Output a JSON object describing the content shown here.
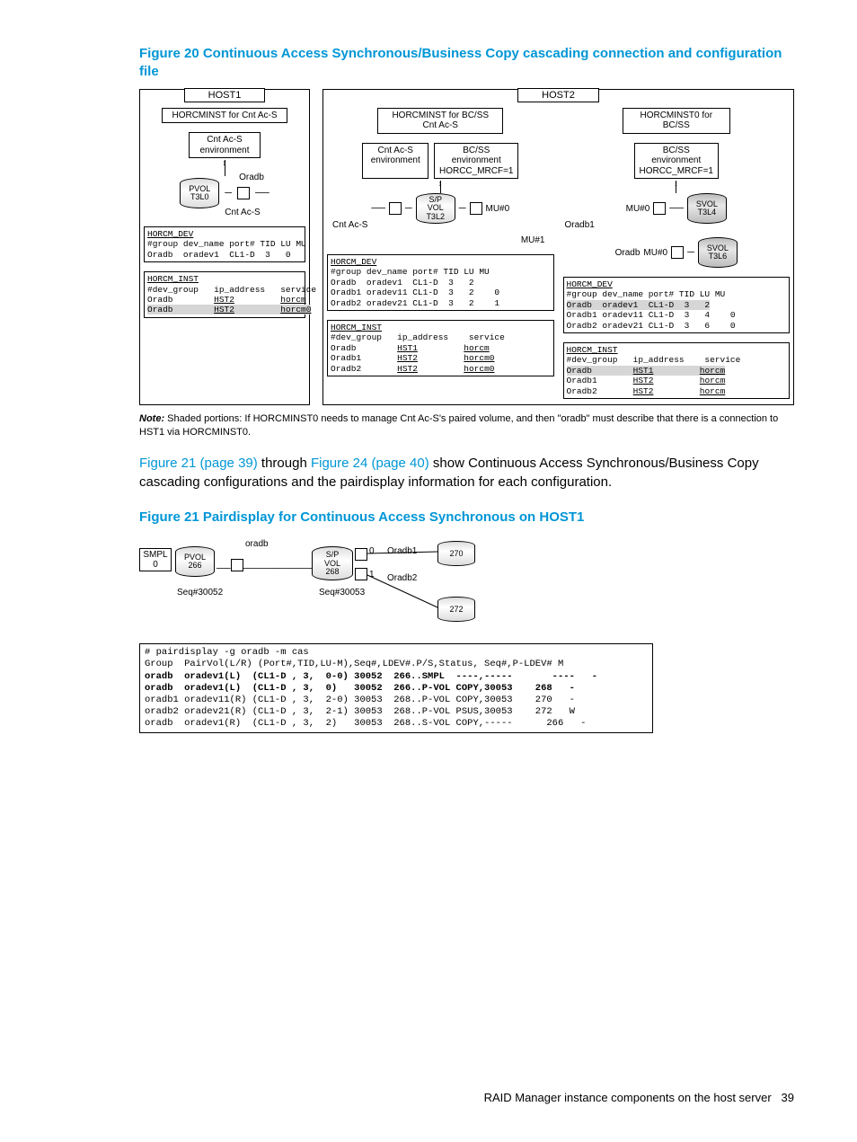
{
  "figure20": {
    "title": "Figure 20  Continuous Access Synchronous/Business Copy cascading connection and configuration file",
    "host1": {
      "label": "HOST1",
      "horcm": "HORCMINST for Cnt Ac-S",
      "env": "Cnt Ac-S\nenvironment",
      "vol": {
        "t1": "PVOL",
        "t2": "T3L0"
      },
      "oradb": "Oradb",
      "link_lbl": "Cnt Ac-S",
      "dev": {
        "head": "HORCM_DEV",
        "hdr": "#group dev_name port# TID LU MU",
        "rows": [
          "Oradb  oradev1  CL1-D  3   0"
        ]
      },
      "inst": {
        "head": "HORCM_INST",
        "hdr": "#dev_group   ip_address   service",
        "rows": [
          [
            "Oradb",
            "HST2",
            "horcm"
          ],
          [
            "Oradb",
            "HST2",
            "horcm0"
          ]
        ]
      }
    },
    "host2": {
      "label": "HOST2",
      "left": {
        "horcm": "HORCMINST for BC/SS\nCnt Ac-S",
        "env": "Cnt Ac-S\nenvironment",
        "env2": "BC/SS\nenvironment\nHORCC_MRCF=1",
        "vol": {
          "t1": "S/P",
          "t2": "VOL",
          "t3": "T3L2"
        },
        "mu0": "MU#0",
        "mu1": "MU#1",
        "link_lbl": "Cnt Ac-S",
        "dev": {
          "head": "HORCM_DEV",
          "hdr": "#group dev_name port# TID LU MU",
          "rows": [
            "Oradb  oradev1  CL1-D  3   2",
            "Oradb1 oradev11 CL1-D  3   2    0",
            "Oradb2 oradev21 CL1-D  3   2    1"
          ]
        },
        "inst": {
          "head": "HORCM_INST",
          "hdr": "#dev_group   ip_address    service",
          "rows": [
            [
              "Oradb",
              "HST1",
              "horcm"
            ],
            [
              "Oradb1",
              "HST2",
              "horcm0"
            ],
            [
              "Oradb2",
              "HST2",
              "horcm0"
            ]
          ]
        }
      },
      "right": {
        "horcm": "HORCMINST0 for\nBC/SS",
        "env": "BC/SS\nenvironment\nHORCC_MRCF=1",
        "vol1": {
          "t1": "SVOL",
          "t2": "T3L4"
        },
        "vol2": {
          "t1": "SVOL",
          "t2": "T3L6"
        },
        "mu0a": "MU#0",
        "mu0b": "MU#0",
        "oradb1": "Oradb1",
        "oradb": "Oradb",
        "dev": {
          "head": "HORCM_DEV",
          "hdr": "#group dev_name port# TID LU MU",
          "rows": [
            {
              "txt": "Oradb  oradev1  CL1-D  3   2",
              "shade": true
            },
            {
              "txt": "Oradb1 oradev11 CL1-D  3   4    0",
              "shade": false
            },
            {
              "txt": "Oradb2 oradev21 CL1-D  3   6    0",
              "shade": false
            }
          ]
        },
        "inst": {
          "head": "HORCM_INST",
          "hdr": "#dev_group   ip_address    service",
          "rows": [
            [
              "Oradb",
              "HST1",
              "horcm",
              true
            ],
            [
              "Oradb1",
              "HST2",
              "horcm",
              false
            ],
            [
              "Oradb2",
              "HST2",
              "horcm",
              false
            ]
          ]
        }
      }
    },
    "note": "Note: Shaded portions: If HORCMINST0 needs to manage Cnt Ac-S's paired volume, and then \"oradb\" must describe that there is a connection to HST1 via HORCMINST0."
  },
  "para": {
    "l1a": "Figure 21 (page 39)",
    "l1b": " through ",
    "l1c": "Figure 24 (page 40)",
    "l1d": " show Continuous Access Synchronous/Business Copy cascading configurations and the pairdisplay information for each configuration."
  },
  "figure21": {
    "title": "Figure 21 Pairdisplay for Continuous Access Synchronous on HOST1",
    "smpl": "SMPL",
    "zero": "0",
    "pvol": {
      "t1": "PVOL",
      "t2": "266"
    },
    "seq1": "Seq#30052",
    "oradb": "oradb",
    "spvol": {
      "t1": "S/P",
      "t2": "VOL",
      "t3": "268"
    },
    "n0": "0",
    "n1": "1",
    "oradb1": "Oradb1",
    "oradb2": "Oradb2",
    "seq2": "Seq#30053",
    "v270": "270",
    "v272": "272",
    "output": [
      "# pairdisplay -g oradb -m cas",
      "Group  PairVol(L/R) (Port#,TID,LU-M),Seq#,LDEV#.P/S,Status, Seq#,P-LDEV# M",
      "oradb  oradev1(L)  (CL1-D , 3,  0-0) 30052  266..SMPL  ----,-----       ----   -",
      "oradb  oradev1(L)  (CL1-D , 3,  0)   30052  266..P-VOL COPY,30053    268   -",
      "oradb1 oradev11(R) (CL1-D , 3,  2-0) 30053  268..P-VOL COPY,30053    270   -",
      "oradb2 oradev21(R) (CL1-D , 3,  2-1) 30053  268..P-VOL PSUS,30053    272   W",
      "oradb  oradev1(R)  (CL1-D , 3,  2)   30053  268..S-VOL COPY,-----      266   -"
    ]
  },
  "footer": {
    "text": "RAID Manager instance components on the host server",
    "page": "39"
  }
}
